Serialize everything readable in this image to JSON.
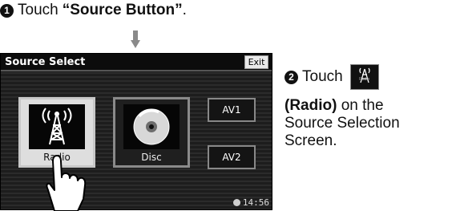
{
  "step1": {
    "number": "1",
    "text": "Touch",
    "button_name": "“Source Button”",
    "suffix": "."
  },
  "screen": {
    "title": "Source Select",
    "exit_label": "Exit",
    "sources": [
      {
        "label": "Radio",
        "icon": "radio-tower-icon"
      },
      {
        "label": "Disc",
        "icon": "disc-icon"
      }
    ],
    "av_buttons": [
      "AV1",
      "AV2"
    ],
    "clock": "14:56"
  },
  "step2": {
    "number": "2",
    "text": "Touch",
    "thumb_label": "Radio",
    "bold_text": "(Radio)",
    "rest_line": " on the",
    "line3": "Source Selection",
    "line4": "Screen."
  },
  "colors": {
    "screen_bg": "#1d1d1d",
    "selected_button": "#dedede",
    "titlebar": "#0c0c0c"
  }
}
